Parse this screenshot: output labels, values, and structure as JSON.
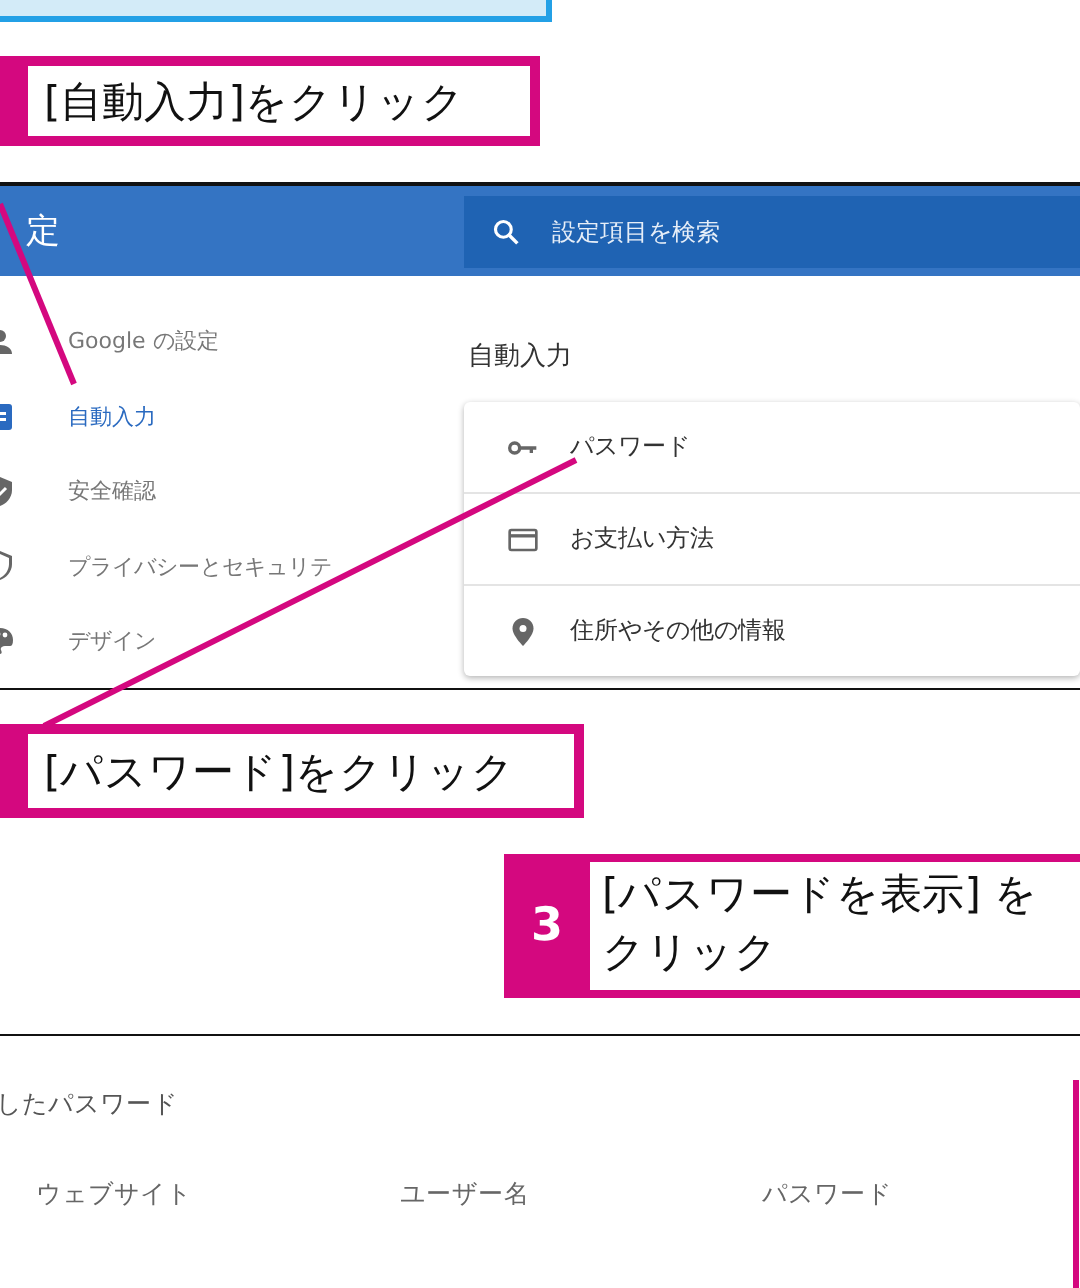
{
  "callouts": [
    {
      "text": "[自動入力]をクリック"
    },
    {
      "text": "[パスワード]をクリック"
    },
    {
      "number": "3",
      "lines": [
        "[パスワードを表示] を",
        "クリック"
      ]
    }
  ],
  "settings": {
    "title": "定",
    "search": {
      "placeholder": "設定項目を検索"
    },
    "sidebar": {
      "items": [
        {
          "label": "Google の設定",
          "selected": false
        },
        {
          "label": "自動入力",
          "selected": true
        },
        {
          "label": "安全確認",
          "selected": false
        },
        {
          "label": "プライバシーとセキュリテ",
          "selected": false
        },
        {
          "label": "デザイン",
          "selected": false
        }
      ]
    },
    "section_title": "自動入力",
    "rows": [
      {
        "label": "パスワード"
      },
      {
        "label": "お支払い方法"
      },
      {
        "label": "住所やその他の情報"
      }
    ]
  },
  "passwords": {
    "heading": "したパスワード",
    "columns": [
      "ウェブサイト",
      "ユーザー名",
      "パスワード"
    ]
  }
}
